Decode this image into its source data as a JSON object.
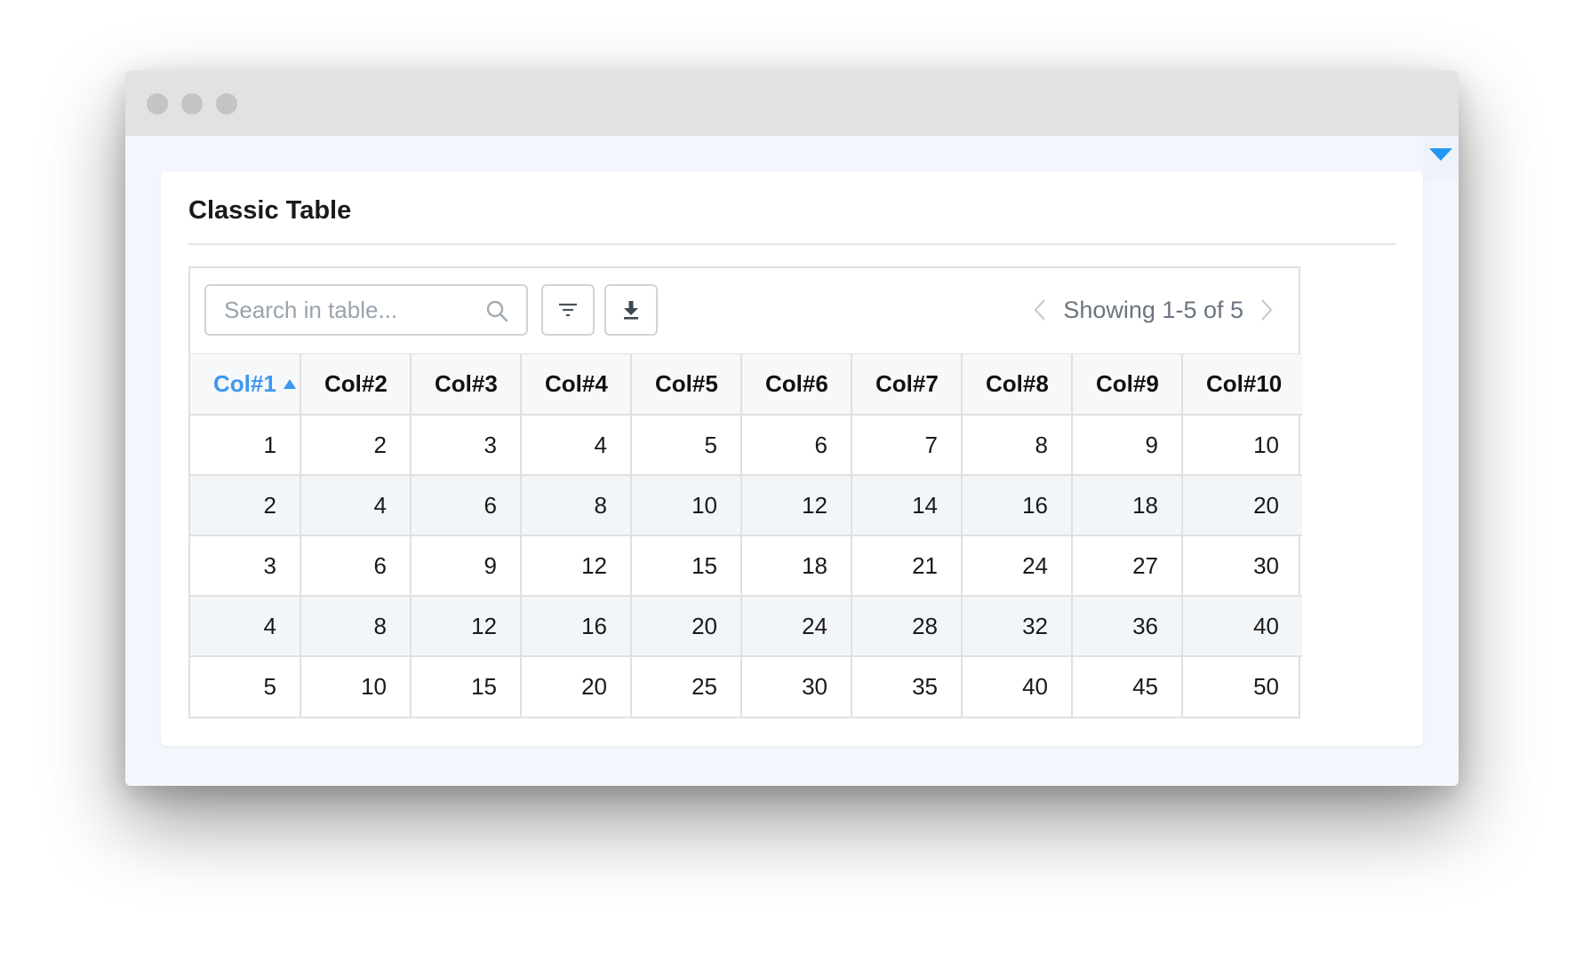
{
  "card": {
    "title": "Classic Table"
  },
  "search": {
    "placeholder": "Search in table...",
    "value": ""
  },
  "pagination": {
    "status": "Showing 1-5 of 5"
  },
  "table": {
    "sorted_column": 0,
    "sort_direction": "ascending",
    "columns": [
      "Col#1",
      "Col#2",
      "Col#3",
      "Col#4",
      "Col#5",
      "Col#6",
      "Col#7",
      "Col#8",
      "Col#9",
      "Col#10"
    ],
    "rows": [
      [
        "1",
        "2",
        "3",
        "4",
        "5",
        "6",
        "7",
        "8",
        "9",
        "10"
      ],
      [
        "2",
        "4",
        "6",
        "8",
        "10",
        "12",
        "14",
        "16",
        "18",
        "20"
      ],
      [
        "3",
        "6",
        "9",
        "12",
        "15",
        "18",
        "21",
        "24",
        "27",
        "30"
      ],
      [
        "4",
        "8",
        "12",
        "16",
        "20",
        "24",
        "28",
        "32",
        "36",
        "40"
      ],
      [
        "5",
        "10",
        "15",
        "20",
        "25",
        "30",
        "35",
        "40",
        "45",
        "50"
      ]
    ]
  },
  "icons": {
    "search": "search-icon",
    "filter": "filter-icon",
    "download": "download-icon",
    "prev": "chevron-left-icon",
    "next": "chevron-right-icon",
    "toggle": "caret-down-icon",
    "sort": "sort-ascending-icon"
  },
  "colors": {
    "accent": "#3d97f0",
    "toggle": "#2196f3",
    "stripe": "#f3f6f9",
    "border": "#e0e0e0"
  }
}
